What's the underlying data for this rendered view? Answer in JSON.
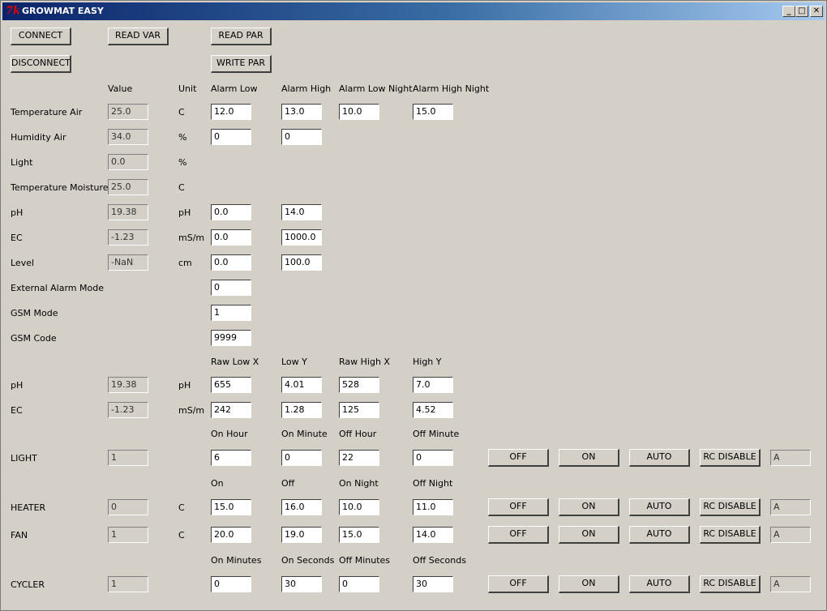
{
  "window": {
    "title": "GROWMAT EASY",
    "icon_glyph": "7k",
    "controls": {
      "minimize": "_",
      "maximize": "□",
      "close": "✕"
    }
  },
  "toolbar": {
    "connect": "CONNECT",
    "disconnect": "DISCONNECT",
    "read_var": "READ VAR",
    "read_par": "READ PAR",
    "write_par": "WRITE PAR"
  },
  "alarm_headers": {
    "value": "Value",
    "unit": "Unit",
    "alarm_low": "Alarm Low",
    "alarm_high": "Alarm High",
    "alarm_low_night": "Alarm Low Night",
    "alarm_high_night": "Alarm High Night"
  },
  "sensors": [
    {
      "label": "Temperature Air",
      "value": "25.0",
      "unit": "C",
      "alarm_low": "12.0",
      "alarm_high": "13.0",
      "alarm_low_night": "10.0",
      "alarm_high_night": "15.0"
    },
    {
      "label": "Humidity Air",
      "value": "34.0",
      "unit": "%",
      "alarm_low": "0",
      "alarm_high": "0"
    },
    {
      "label": "Light",
      "value": "0.0",
      "unit": "%"
    },
    {
      "label": "Temperature Moisture",
      "value": "25.0",
      "unit": "C"
    },
    {
      "label": "pH",
      "value": "19.38",
      "unit": "pH",
      "alarm_low": "0.0",
      "alarm_high": "14.0"
    },
    {
      "label": "EC",
      "value": "-1.23",
      "unit": "mS/m",
      "alarm_low": "0.0",
      "alarm_high": "1000.0"
    },
    {
      "label": "Level",
      "value": "-NaN",
      "unit": "cm",
      "alarm_low": "0.0",
      "alarm_high": "100.0"
    }
  ],
  "modes": [
    {
      "label": "External Alarm Mode",
      "value": "0"
    },
    {
      "label": "GSM Mode",
      "value": "1"
    },
    {
      "label": "GSM Code",
      "value": "9999"
    }
  ],
  "calib_headers": {
    "raw_low_x": "Raw Low X",
    "low_y": "Low Y",
    "raw_high_x": "Raw High X",
    "high_y": "High Y"
  },
  "calibration": [
    {
      "label": "pH",
      "value": "19.38",
      "unit": "pH",
      "raw_low_x": "655",
      "low_y": "4.01",
      "raw_high_x": "528",
      "high_y": "7.0"
    },
    {
      "label": "EC",
      "value": "-1.23",
      "unit": "mS/m",
      "raw_low_x": "242",
      "low_y": "1.28",
      "raw_high_x": "125",
      "high_y": "4.52"
    }
  ],
  "control_buttons": {
    "off": "OFF",
    "on": "ON",
    "auto": "AUTO",
    "rc_disable": "RC DISABLE"
  },
  "light_headers": {
    "on_hour": "On Hour",
    "on_minute": "On Minute",
    "off_hour": "Off Hour",
    "off_minute": "Off Minute"
  },
  "light": {
    "label": "LIGHT",
    "value": "1",
    "on_hour": "6",
    "on_minute": "0",
    "off_hour": "22",
    "off_minute": "0",
    "mode": "A"
  },
  "thermo_headers": {
    "on": "On",
    "off": "Off",
    "on_night": "On Night",
    "off_night": "Off Night"
  },
  "heater": {
    "label": "HEATER",
    "value": "0",
    "unit": "C",
    "on": "15.0",
    "off": "16.0",
    "on_night": "10.0",
    "off_night": "11.0",
    "mode": "A"
  },
  "fan": {
    "label": "FAN",
    "value": "1",
    "unit": "C",
    "on": "20.0",
    "off": "19.0",
    "on_night": "15.0",
    "off_night": "14.0",
    "mode": "A"
  },
  "cycler_headers": {
    "on_minutes": "On Minutes",
    "on_seconds": "On Seconds",
    "off_minutes": "Off Minutes",
    "off_seconds": "Off Seconds"
  },
  "cycler": {
    "label": "CYCLER",
    "value": "1",
    "on_minutes": "0",
    "on_seconds": "30",
    "off_minutes": "0",
    "off_seconds": "30",
    "mode": "A"
  },
  "colors": {
    "title_start": "#0a246a",
    "title_end": "#a6caf0",
    "face": "#d4d0c8",
    "icon": "#e00000"
  }
}
